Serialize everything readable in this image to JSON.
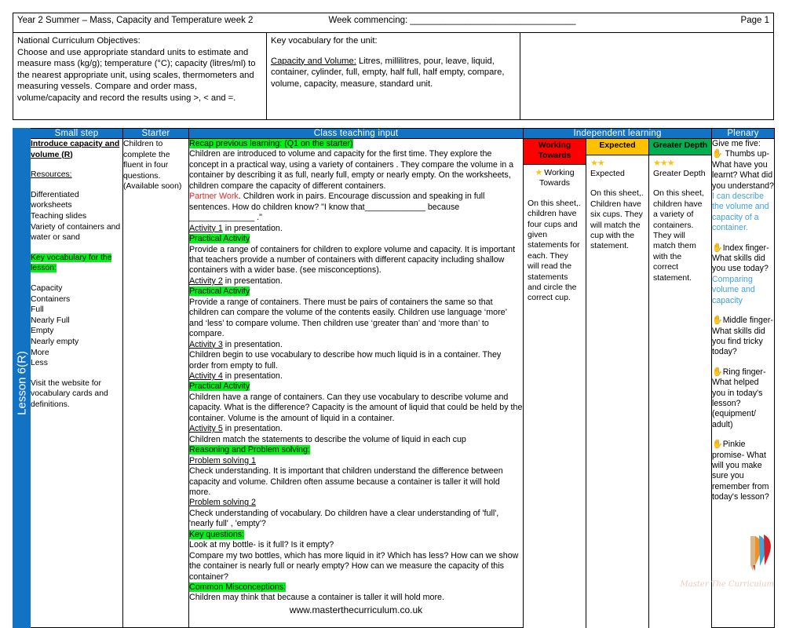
{
  "meta": {
    "title": "Year 2 Summer – Mass, Capacity and Temperature week 2",
    "week_commencing": "Week commencing: _________________________________",
    "page": "Page 1"
  },
  "objectives": {
    "heading": "National Curriculum Objectives:",
    "line1": "Choose and use appropriate standard units to estimate and measure mass (kg/g); temperature (°C); capacity (litres/ml) to the nearest appropriate unit, using scales, thermometers and measuring vessels.",
    "line2": "Compare and order mass, volume/capacity and record the results using >, < and =."
  },
  "vocabulary": {
    "heading": "Key vocabulary for the unit:",
    "label": "Capacity and Volume:",
    "words": " Litres, millilitres, pour, leave, liquid, container, cylinder, full, empty, half full, half empty, compare, volume, capacity, measure, standard unit."
  },
  "columns": {
    "small_step": "Small step",
    "starter": "Starter",
    "class_teaching_input": "Class teaching input",
    "independent_learning": "Independent learning",
    "plenary": "Plenary"
  },
  "lesson_tab": "Lesson 6(R)",
  "small_step": {
    "title": "Introduce capacity and volume (R)",
    "resources_heading": "Resources:",
    "resources": [
      "Differentiated worksheets",
      "Teaching slides",
      "Variety of containers and water or sand"
    ],
    "key_vocab_heading": "Key vocabulary for the lesson:",
    "vocab_list": [
      "Capacity",
      "Containers",
      "Full",
      "Nearly Full",
      "Empty",
      "Nearly empty",
      "More",
      "Less"
    ],
    "footer": "Visit the website for vocabulary cards and definitions."
  },
  "starter": {
    "text": "Children to complete the fluent in four questions. (Available soon)"
  },
  "teaching": {
    "recap_heading": "Recap previous learning: (Q1 on the starter)",
    "recap_body": "Children are introduced to volume and capacity for the first time. They explore the concept in a practical way, using a variety of containers . They compare the volume in a container by describing it as full, nearly full, empty or nearly empty. On the worksheets, children compare the capacity of different containers.",
    "partner_work_label": "Partner Work",
    "partner_work_body": ". Children work in pairs. Encourage discussion and speaking in full sentences. How do children know?  \"I know that_____________ because ______________ .\"",
    "activity1": "Activity 1",
    "activity1_rest": " in presentation.",
    "practical1": "Practical Activity",
    "practical1_body": "Provide a range of containers for children to explore volume and capacity. It is important that teachers provide a number of  containers with different capacity including shallow containers with a wider base. (see misconceptions).",
    "activity2": "Activity 2",
    "activity2_rest": " in presentation.",
    "practical2": "Practical Activity",
    "practical2_body": "Provide a range of containers. There must be pairs of containers the same so that children can compare the volume of the contents easily. Children use language ‘more’ and ‘less’ to compare volume. Then children use ‘greater than’ and ‘more than’ to compare.",
    "activity3": "Activity 3",
    "activity3_rest": " in presentation.",
    "activity3_body": "Children begin to use vocabulary to describe how much liquid is in a container. They order from empty to full.",
    "activity4": "Activity 4",
    "activity4_rest": " in presentation.",
    "practical3": "Practical Activity",
    "practical3_body": "Children have a range of containers. Can they use vocabulary to describe volume and capacity. What is the difference? Capacity is the amount of liquid that could be held by the container. Volume is the amount of liquid in a container.",
    "activity5": "Activity 5",
    "activity5_rest": " in presentation.",
    "activity5_body": "Children match the statements to describe the volume of liquid in each cup",
    "reasoning_heading": "Reasoning and Problem solving:",
    "ps1_heading": "Problem solving 1",
    "ps1_body": "Check understanding.  It is important that children understand the difference between capacity and volume. Children often assume because a container is taller it will hold more.",
    "ps2_heading": "Problem solving 2",
    "ps2_body": "Check understanding of vocabulary. Do children have a clear understanding of 'full', 'nearly full' , 'empty'?",
    "key_questions_heading": "Key questions:",
    "key_q1": "Look at my bottle- is it full? Is it empty?",
    "key_q2": "Compare my two bottles, which has more liquid in it? Which has less? How can we show the container is nearly full or nearly empty? How can we measure the capacity of this container?",
    "misconceptions_heading": "Common Misconceptions:",
    "misconceptions_body": "Children may think that because a container is taller it will hold more.",
    "website": "www.masterthecurriculum.co.uk"
  },
  "attainment": {
    "working_towards_label": "Working Towards",
    "expected_label": "Expected",
    "greater_depth_label": "Greater Depth",
    "working_towards_stars": "★",
    "expected_stars": "★★",
    "greater_depth_stars": "★★★",
    "working_towards_title": " Working Towards",
    "expected_title": "Expected",
    "greater_depth_title": "Greater Depth",
    "working_towards_body": "On this sheet,. children have four cups and given statements for each. They will read the statements and circle the correct cup.",
    "expected_body": "On this sheet,. Children have six cups. They will match the cup with the statement.",
    "greater_depth_body": "On this sheet, children have a variety of containers. They will match them with the correct statement."
  },
  "plenary": {
    "intro": "Give me five:",
    "hand": "✋",
    "items": [
      {
        "question": " Thumbs up- What have you learnt? What did you understand?",
        "answer": "I can describe the volume and capacity of a container."
      },
      {
        "question": "Index finger- What skills did you use today?",
        "answer": "Comparing volume and capacity"
      },
      {
        "question": "Middle finger- What skills did you find tricky today?",
        "answer": ""
      },
      {
        "question": "Ring finger- What helped you in today's lesson? (equipment/ adult)",
        "answer": ""
      },
      {
        "question": "Pinkie promise- What will you make sure you remember from today's lesson?",
        "answer": ""
      }
    ]
  },
  "watermark": "Master The Curriculum",
  "colors": {
    "header_blue": "#1272C4",
    "highlight_green": "#00F315",
    "working_towards": "#FF0000",
    "expected": "#FFC000",
    "greater_depth": "#00B050",
    "answer_blue": "#3FA0E0",
    "partner_red": "#FF2020"
  }
}
